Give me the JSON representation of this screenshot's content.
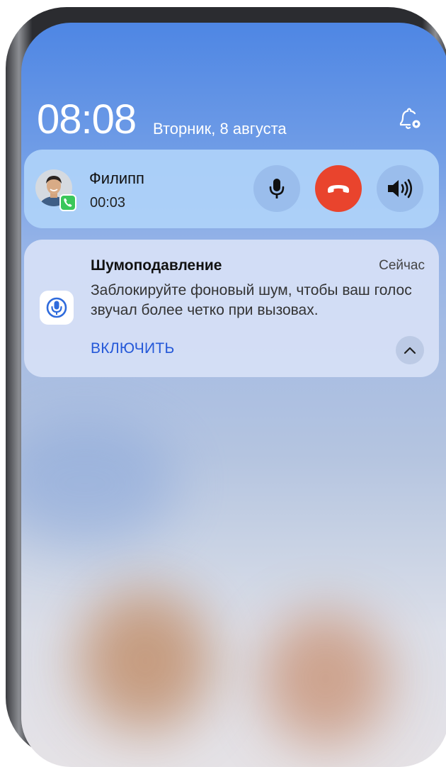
{
  "status": {
    "time": "08:08",
    "date": "Вторник, 8 августа"
  },
  "call": {
    "caller_name": "Филипп",
    "duration": "00:03"
  },
  "notification": {
    "title": "Шумоподавление",
    "time": "Сейчас",
    "body": "Заблокируйте фоновый шум, чтобы ваш голос звучал более четко при вызовах.",
    "action_label": "ВКЛЮЧИТЬ"
  },
  "icons": {
    "bell": "bell-settings-icon",
    "mic": "microphone-icon",
    "end_call": "phone-hangup-icon",
    "speaker": "speaker-icon",
    "app": "noise-cancel-mic-icon",
    "collapse": "chevron-up-icon"
  },
  "colors": {
    "end_call": "#e9442d",
    "action": "#2458d8",
    "badge": "#3ac75a"
  }
}
